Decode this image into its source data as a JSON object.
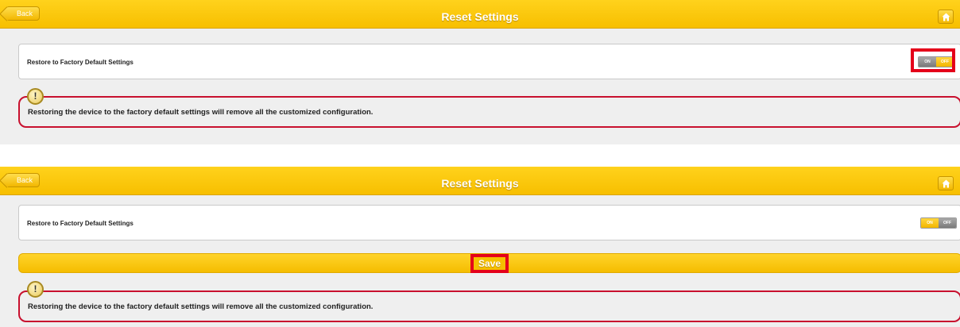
{
  "panels": [
    {
      "topbar": {
        "back_label": "Back",
        "title": "Reset Settings"
      },
      "setting": {
        "label": "Restore to Factory Default Settings",
        "toggle_on": "ON",
        "toggle_off": "OFF",
        "state": "OFF"
      },
      "warning": {
        "icon": "!",
        "text": "Restoring the device to the factory default settings will remove all the customized configuration."
      }
    },
    {
      "topbar": {
        "back_label": "Back",
        "title": "Reset Settings"
      },
      "setting": {
        "label": "Restore to Factory Default Settings",
        "toggle_on": "ON",
        "toggle_off": "OFF",
        "state": "ON"
      },
      "save_label": "Save",
      "warning": {
        "icon": "!",
        "text": "Restoring the device to the factory default settings will remove all the customized configuration."
      }
    }
  ],
  "colors": {
    "accent": "#f7bf00",
    "highlight": "#e4001a",
    "warning_border": "#c8102e"
  },
  "icons": {
    "back": "back-arrow-icon",
    "home": "home-icon",
    "warning": "exclamation-icon"
  }
}
